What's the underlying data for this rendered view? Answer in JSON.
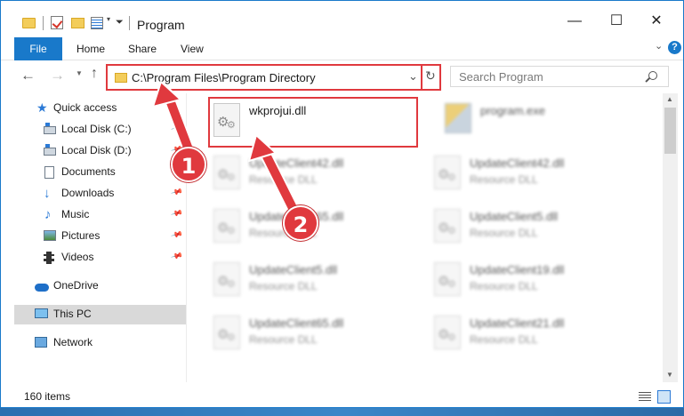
{
  "window": {
    "title": "Program",
    "minimize_glyph": "—",
    "maximize_glyph": "☐",
    "close_glyph": "✕"
  },
  "ribbon": {
    "tabs": [
      "File",
      "Home",
      "Share",
      "View"
    ]
  },
  "address": {
    "path": "C:\\Program Files\\Program Directory"
  },
  "search": {
    "placeholder": "Search Program"
  },
  "sidebar": {
    "items": [
      {
        "label": "Quick access",
        "icon": "star-icon",
        "pinned": false
      },
      {
        "label": "Local Disk (C:)",
        "icon": "drive-icon",
        "pinned": true
      },
      {
        "label": "Local Disk (D:)",
        "icon": "drive-icon",
        "pinned": true
      },
      {
        "label": "Documents",
        "icon": "documents-icon",
        "pinned": true
      },
      {
        "label": "Downloads",
        "icon": "download-icon",
        "pinned": true
      },
      {
        "label": "Music",
        "icon": "music-icon",
        "pinned": true
      },
      {
        "label": "Pictures",
        "icon": "pictures-icon",
        "pinned": true
      },
      {
        "label": "Videos",
        "icon": "videos-icon",
        "pinned": true
      },
      {
        "label": "OneDrive",
        "icon": "cloud-icon",
        "pinned": false
      },
      {
        "label": "This PC",
        "icon": "computer-icon",
        "pinned": false,
        "selected": true
      },
      {
        "label": "Network",
        "icon": "network-icon",
        "pinned": false
      }
    ]
  },
  "files": [
    {
      "name": "wkprojui.dll",
      "type": ""
    },
    {
      "name": "program.exe",
      "type": ""
    },
    {
      "name": "UpdateClient42.dll",
      "type": "Resource DLL"
    },
    {
      "name": "UpdateClient42.dll",
      "type": "Resource DLL"
    },
    {
      "name": "UpdateClient65.dll",
      "type": "Resource DLL"
    },
    {
      "name": "UpdateClient5.dll",
      "type": "Resource DLL"
    },
    {
      "name": "UpdateClient5.dll",
      "type": "Resource DLL"
    },
    {
      "name": "UpdateClient19.dll",
      "type": "Resource DLL"
    },
    {
      "name": "UpdateClient65.dll",
      "type": "Resource DLL"
    },
    {
      "name": "UpdateClient21.dll",
      "type": "Resource DLL"
    }
  ],
  "status": {
    "item_count": "160 items"
  },
  "annotations": {
    "step1": "1",
    "step2": "2",
    "accent_color": "#e0393e"
  }
}
